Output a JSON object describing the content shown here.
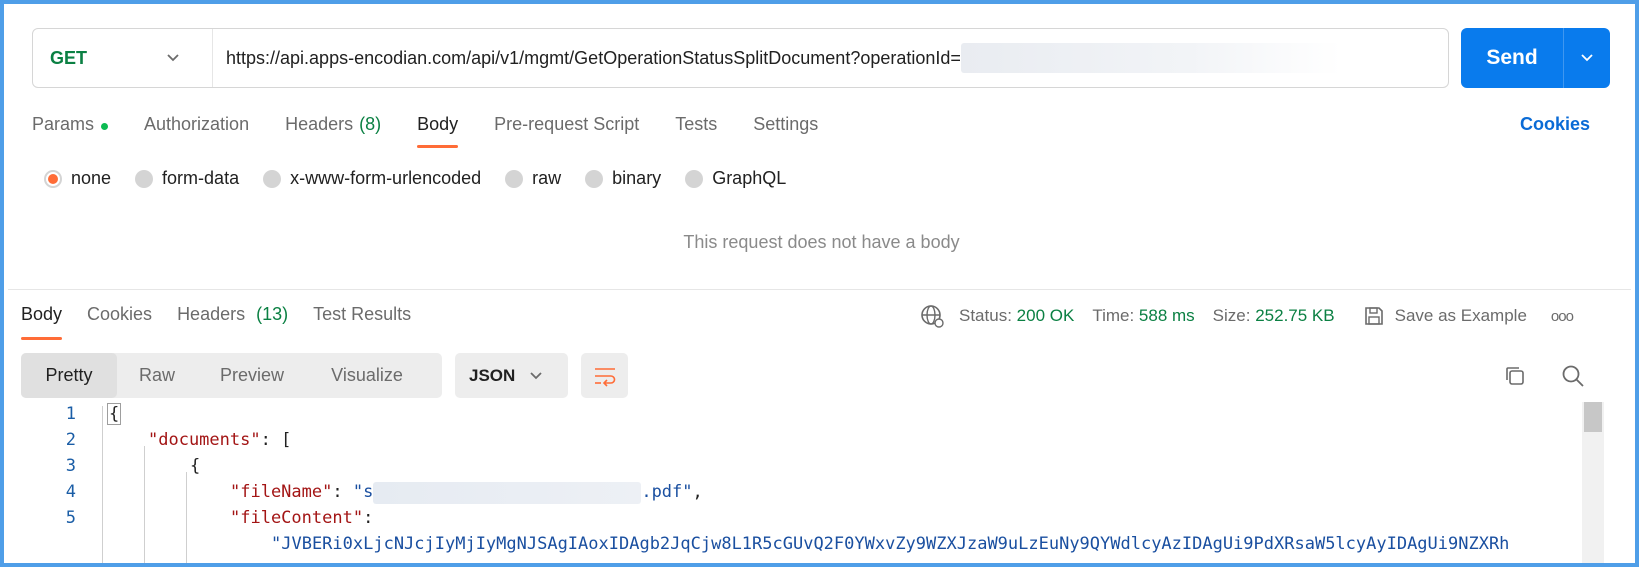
{
  "request": {
    "method": "GET",
    "url_prefix": "https://api.apps-encodian.com/api/v1/mgmt/GetOperationStatusSplitDocument?operationId=",
    "send_label": "Send"
  },
  "request_tabs": [
    {
      "label": "Params",
      "count": ""
    },
    {
      "label": "Authorization",
      "count": ""
    },
    {
      "label": "Headers",
      "count": "(8)"
    },
    {
      "label": "Body",
      "count": ""
    },
    {
      "label": "Pre-request Script",
      "count": ""
    },
    {
      "label": "Tests",
      "count": ""
    },
    {
      "label": "Settings",
      "count": ""
    }
  ],
  "cookies_label": "Cookies",
  "body_types": [
    "none",
    "form-data",
    "x-www-form-urlencoded",
    "raw",
    "binary",
    "GraphQL"
  ],
  "no_body_text": "This request does not have a body",
  "response_tabs": [
    {
      "label": "Body",
      "count": ""
    },
    {
      "label": "Cookies",
      "count": ""
    },
    {
      "label": "Headers",
      "count": "(13)"
    },
    {
      "label": "Test Results",
      "count": ""
    }
  ],
  "response_meta": {
    "status_label": "Status:",
    "status_value": "200 OK",
    "time_label": "Time:",
    "time_value": "588 ms",
    "size_label": "Size:",
    "size_value": "252.75 KB",
    "save_label": "Save as Example",
    "more_label": "ooo"
  },
  "view_modes": [
    "Pretty",
    "Raw",
    "Preview",
    "Visualize"
  ],
  "format": "JSON",
  "code_lines": {
    "l1": {
      "num": "1",
      "text": "{"
    },
    "l2": {
      "num": "2",
      "key": "\"documents\"",
      "rest": ": ["
    },
    "l3": {
      "num": "3",
      "text": "{"
    },
    "l4": {
      "num": "4",
      "key": "\"fileName\"",
      "sep": ": ",
      "str_start": "\"s",
      "str_end": ".pdf\"",
      "rest": ","
    },
    "l5": {
      "num": "5",
      "key": "\"fileContent\"",
      "rest": ":"
    },
    "l6": {
      "num": "",
      "str": "\"JVBERi0xLjcNJcjIyMjIyMgNJSAgIAoxIDAgb2JqCjw8L1R5cGUvQ2F0YWxvZy9WZXJzaW9uLzEuNy9QYWdlcyAzIDAgUi9PdXRsaW5lcyAyIDAgUi9NZXRh"
    }
  }
}
